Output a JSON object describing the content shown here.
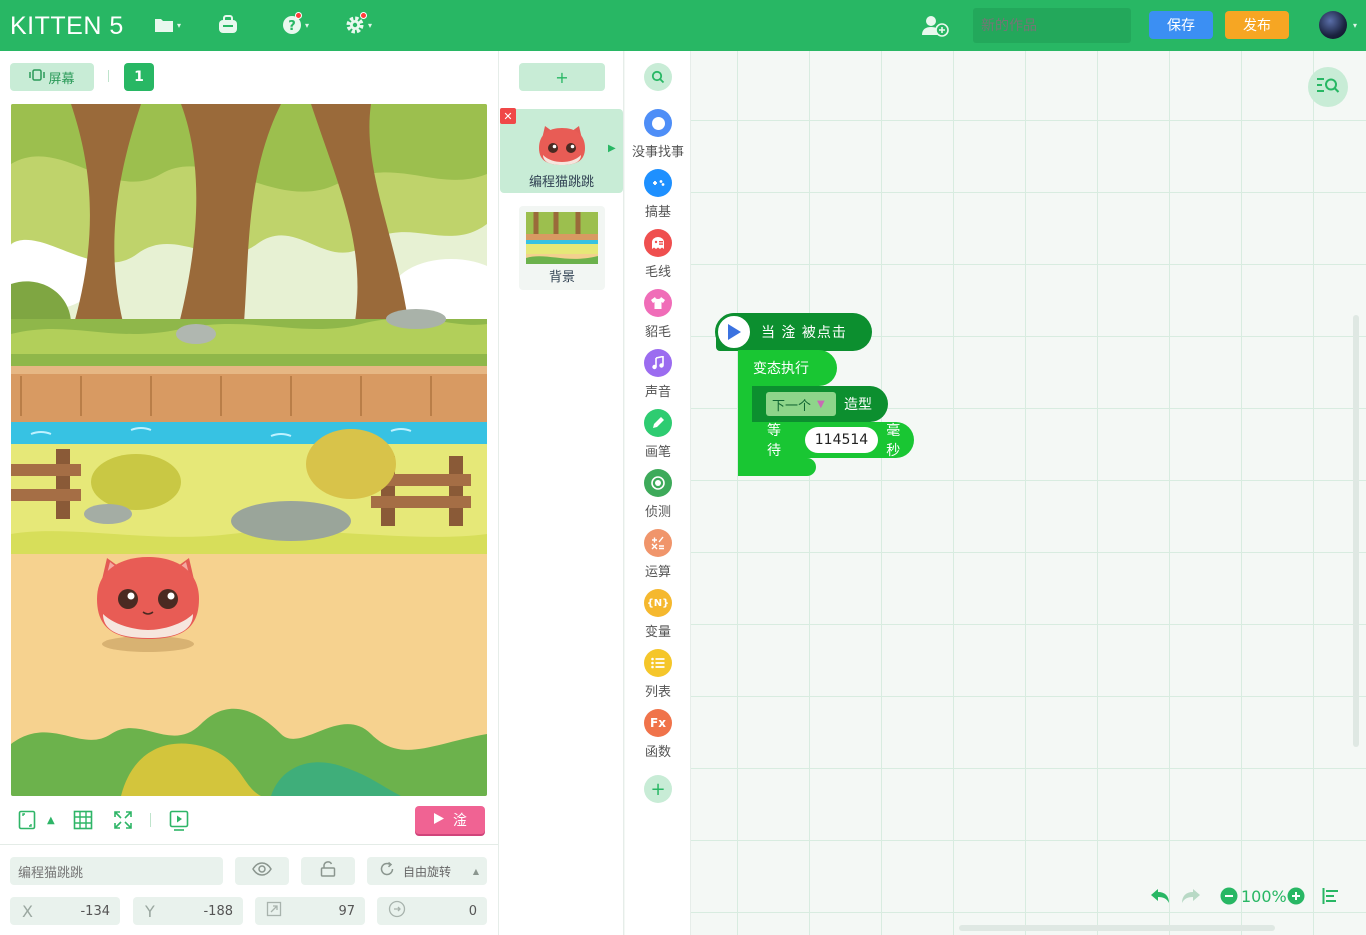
{
  "app": {
    "logo": "KITTEN 5",
    "project_title_placeholder": "新的作品",
    "save_label": "保存",
    "publish_label": "发布"
  },
  "stage": {
    "screen_label": "屏幕",
    "scene_number": "1",
    "run_label": "淦"
  },
  "sprite_props": {
    "name_placeholder": "编程猫跳跳",
    "rotation_label": "自由旋转",
    "x_label": "X",
    "x_value": "-134",
    "y_label": "Y",
    "y_value": "-188",
    "size_value": "97",
    "direction_value": "0"
  },
  "sprites": [
    {
      "name": "编程猫跳跳"
    },
    {
      "name": "背景"
    }
  ],
  "add_sprite_label": "+",
  "categories": [
    {
      "label": "没事找事",
      "color": "#4e8ef7",
      "icon": "toggle-icon"
    },
    {
      "label": "搞基",
      "color": "#1e90ff",
      "icon": "gamepad-icon"
    },
    {
      "label": "毛线",
      "color": "#ef4f4f",
      "icon": "ghost-icon"
    },
    {
      "label": "貂毛",
      "color": "#f06db8",
      "icon": "shirt-icon"
    },
    {
      "label": "声音",
      "color": "#9b6cf0",
      "icon": "music-icon"
    },
    {
      "label": "画笔",
      "color": "#2ecc71",
      "icon": "pen-icon"
    },
    {
      "label": "侦测",
      "color": "#3daa5a",
      "icon": "target-icon"
    },
    {
      "label": "运算",
      "color": "#f0956b",
      "icon": "math-icon"
    },
    {
      "label": "变量",
      "color": "#f5b82e",
      "icon": "variable-icon"
    },
    {
      "label": "列表",
      "color": "#f5c62a",
      "icon": "list-icon"
    },
    {
      "label": "函数",
      "color": "#f0734a",
      "icon": "function-icon"
    }
  ],
  "category_var_icon_text": "{N}",
  "category_fx_icon_text": "Fx",
  "blocks": {
    "hat_label": "当 淦 被点击",
    "loop_label": "变态执行",
    "costume_dropdown": "下一个",
    "costume_label": "造型",
    "wait_label": "等待",
    "wait_value": "114514",
    "wait_unit": "毫秒"
  },
  "workspace": {
    "zoom": "100%"
  }
}
